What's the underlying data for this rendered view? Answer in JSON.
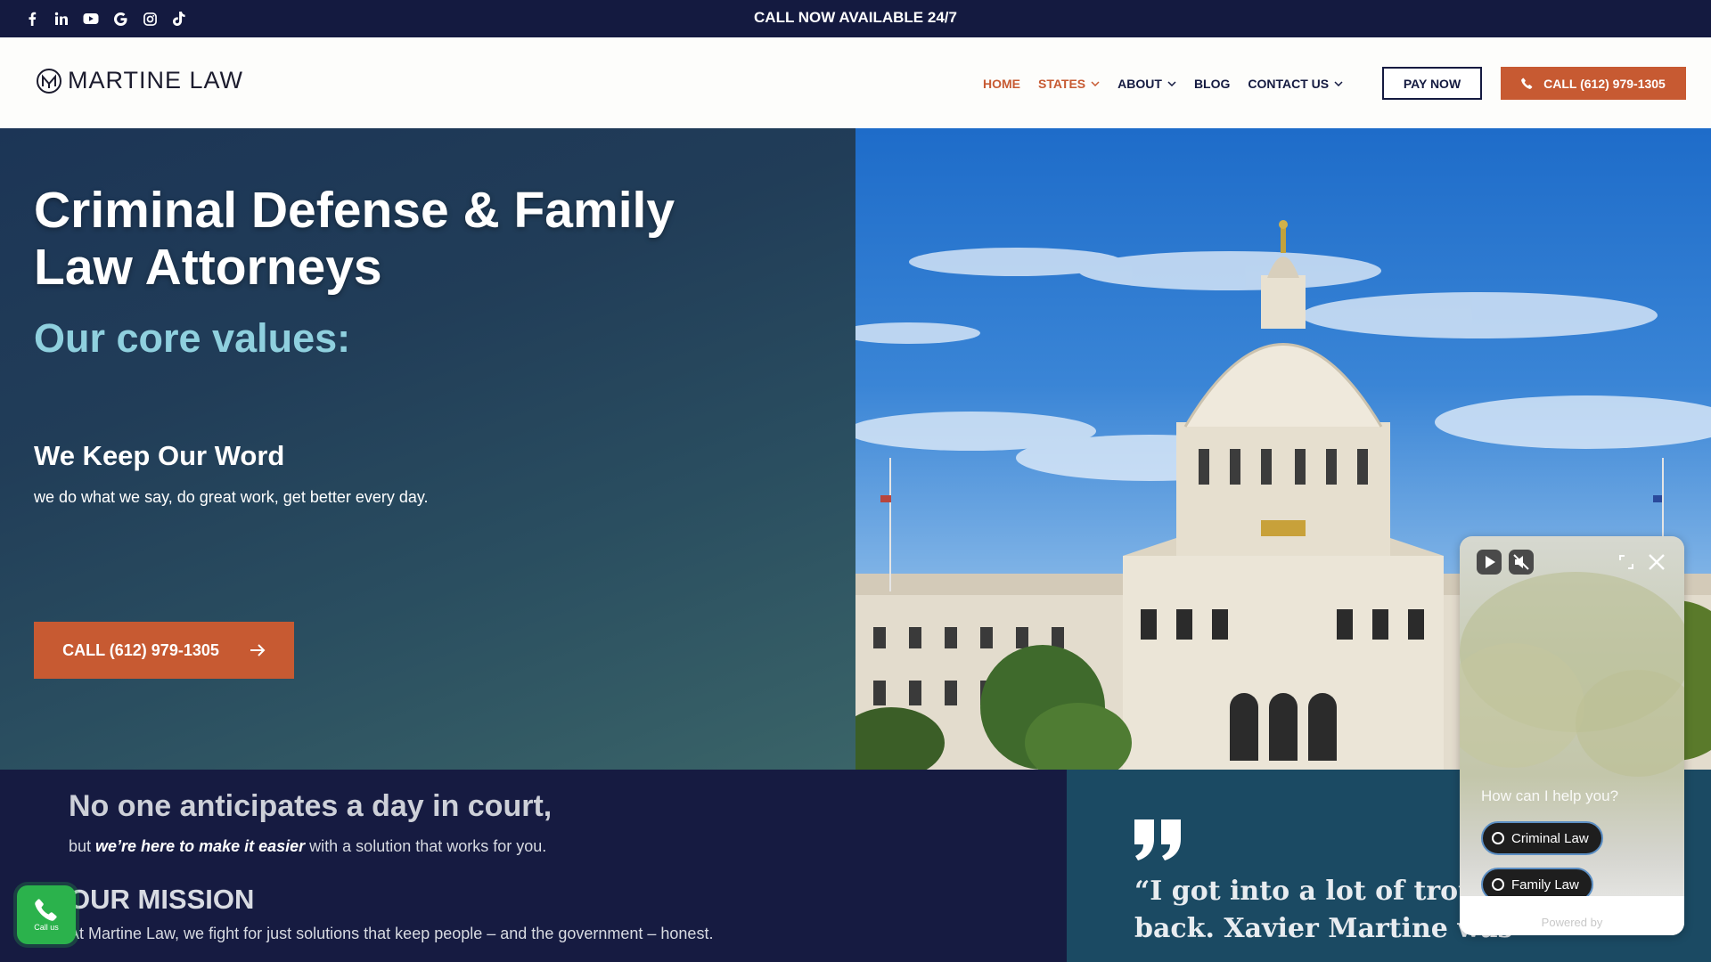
{
  "topbar": {
    "social_icons": [
      "facebook-icon",
      "linkedin-icon",
      "youtube-icon",
      "google-icon",
      "instagram-icon",
      "tiktok-icon"
    ],
    "announcement": "CALL NOW AVAILABLE 24/7"
  },
  "header": {
    "logo_text": "MARTINE LAW",
    "nav": [
      {
        "label": "HOME",
        "active": true
      },
      {
        "label": "STATES",
        "dropdown": true
      },
      {
        "label": "ABOUT",
        "dropdown": true
      },
      {
        "label": "BLOG"
      },
      {
        "label": "CONTACT US",
        "dropdown": true
      }
    ],
    "pay_now": "PAY NOW",
    "call_label": "CALL (612) 979-1305"
  },
  "hero": {
    "title": "Criminal Defense & Family Law Attorneys",
    "subtitle": "Our core values:",
    "value_title": "We Keep Our Word",
    "value_text": "we do what we say, do great work, get better every day.",
    "call_label": "CALL (612) 979-1305"
  },
  "lower": {
    "title": "No one anticipates a day in court,",
    "text_pre": "but ",
    "text_em": "we’re here to make it easier",
    "text_post": " with a solution that works for you.",
    "mission_title": "OUR MISSION",
    "mission_text": "At Martine Law, we fight for just solutions that keep people – and the government – honest.",
    "quote_line1": "“I got into a lot of trouble",
    "quote_line2": "back. Xavier Martine was"
  },
  "callus": {
    "label": "Call us"
  },
  "widget": {
    "prompt": "How can I help you?",
    "options": [
      "Criminal Law",
      "Family Law"
    ],
    "powered_by": "Powered by"
  },
  "colors": {
    "navy": "#141a40",
    "accent_orange": "#c75a32",
    "teal_sub": "#8fd0de",
    "call_green": "#2bb24c"
  }
}
